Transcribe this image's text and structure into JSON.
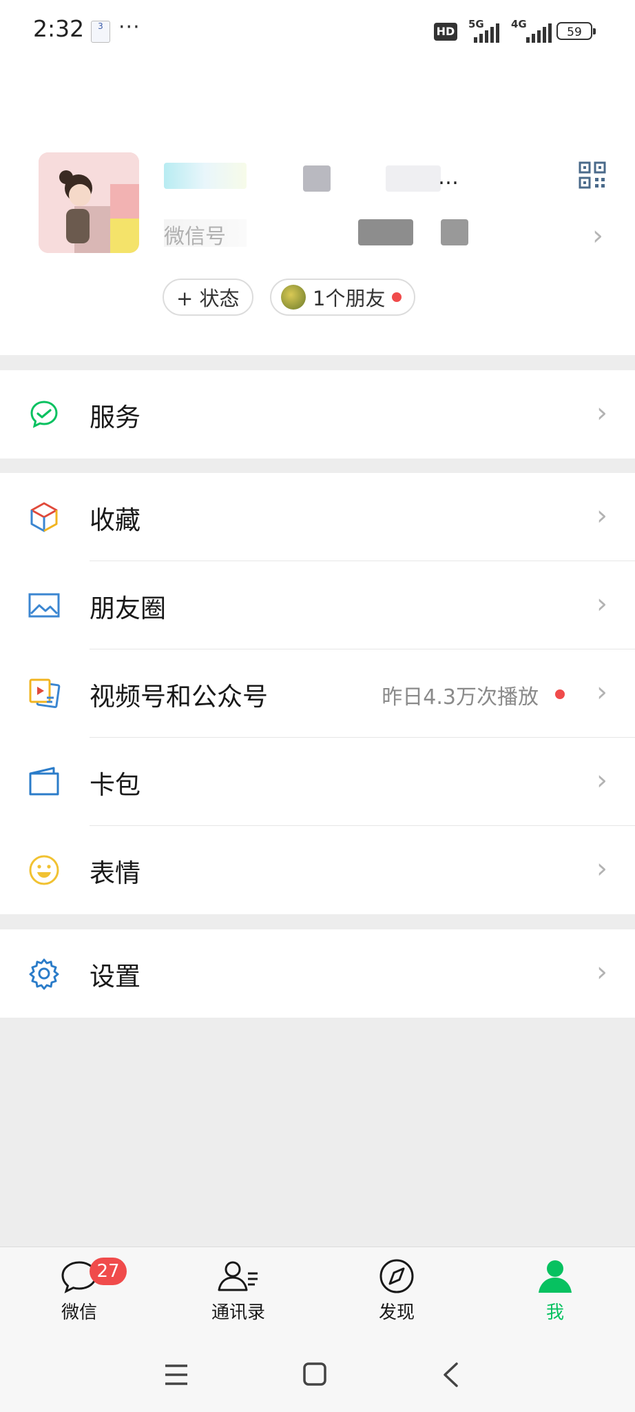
{
  "status_bar": {
    "time": "2:32",
    "notif_icon_text": "3",
    "more": "···",
    "hd_label": "HD",
    "net1": "5G",
    "net2": "4G",
    "battery": "59"
  },
  "profile": {
    "nickname_suffix": "…",
    "wechat_id_prefix": "微信号",
    "status_button": "+ 状态",
    "friends_button": "1个朋友"
  },
  "menu": {
    "service": "服务",
    "favorites": "收藏",
    "moments": "朋友圈",
    "channels": "视频号和公众号",
    "channels_sub": "昨日4.3万次播放",
    "cards": "卡包",
    "stickers": "表情",
    "settings": "设置"
  },
  "tabs": {
    "chats": "微信",
    "chats_badge": "27",
    "contacts": "通讯录",
    "discover": "发现",
    "me": "我",
    "active": "me"
  },
  "colors": {
    "accent": "#07c160",
    "badge_red": "#f04b4b",
    "page_bg": "#ededed"
  }
}
